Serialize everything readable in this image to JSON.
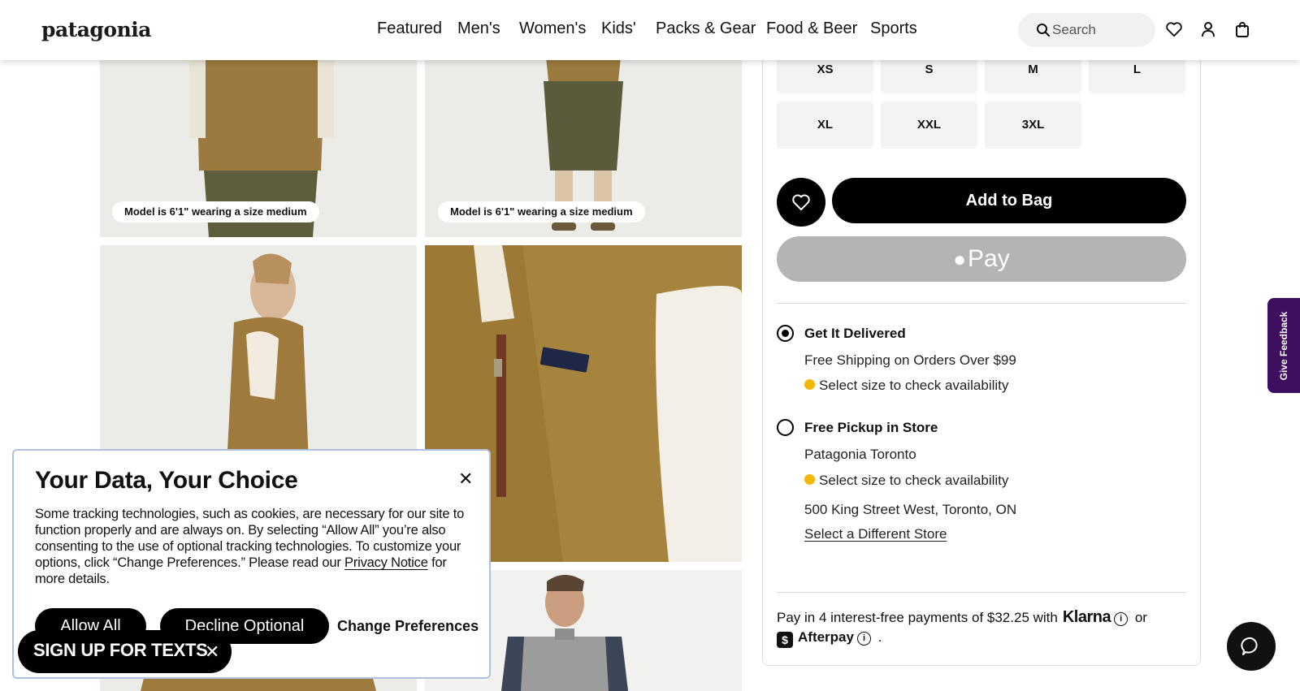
{
  "header": {
    "logo": "patagonia",
    "nav": [
      "Featured",
      "Men's",
      "Women's",
      "Kids'",
      "Packs & Gear",
      "Food & Beer",
      "Sports"
    ],
    "search_placeholder": "Search"
  },
  "gallery": {
    "captions": [
      "Model is 6'1\" wearing a size medium",
      "Model is 6'1\" wearing a size medium"
    ]
  },
  "product": {
    "sizes": [
      "XS",
      "S",
      "M",
      "L",
      "XL",
      "XXL",
      "3XL"
    ],
    "add_to_bag": "Add to Bag",
    "apple_pay": "Pay",
    "delivery": {
      "title": "Get It Delivered",
      "shipping": "Free Shipping on Orders Over $99",
      "availability": "Select size to check availability",
      "selected": true
    },
    "pickup": {
      "title": "Free Pickup in Store",
      "store": "Patagonia Toronto",
      "availability": "Select size to check availability",
      "address": "500 King Street West, Toronto, ON",
      "change_store": "Select a Different Store",
      "selected": false
    },
    "payment": {
      "line": "Pay in 4 interest-free payments of $32.25 with",
      "klarna": "Klarna",
      "or": "or",
      "afterpay": "Afterpay",
      "period": "."
    }
  },
  "feedback_tab": "Give Feedback",
  "cookie": {
    "title": "Your Data, Your Choice",
    "body_before": "Some tracking technologies, such as cookies, are necessary for our site to function properly and are always on. By selecting “Allow All” you’re also consenting to the use of optional tracking technologies. To customize your options, click “Change Preferences.” Please read our ",
    "privacy_link": "Privacy Notice",
    "body_after": " for more details.",
    "allow_all": "Allow All",
    "decline": "Decline Optional",
    "change": "Change Preferences"
  },
  "sms_banner": "SIGN UP FOR TEXTS",
  "colors": {
    "accent_dot": "#f2b705",
    "feedback_bg": "#3d0f5e",
    "apple_pay_bg": "#b4b4b4"
  }
}
